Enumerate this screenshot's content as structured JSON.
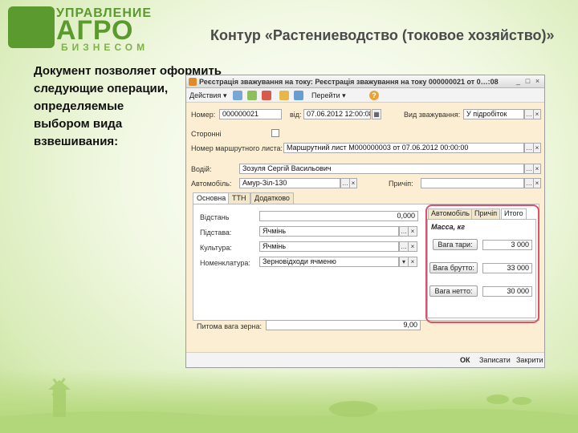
{
  "logo": {
    "top": "УПРАВЛЕНИЕ",
    "big": "АГРО",
    "bottom": "БИЗНЕСОМ"
  },
  "slide_title": "Контур «Растениеводство (токовое хозяйство)»",
  "description": [
    "Документ позволяет оформить",
    "следующие операции,",
    "определяемые",
    "выбором вида",
    "взвешивания:"
  ],
  "window": {
    "title": "Реєстрація зважування на току: Реєстрація зважування на току 000000021 от 0…:08",
    "controls": {
      "minimize": "_",
      "maximize": "□",
      "close": "×"
    },
    "toolbar": {
      "actions": "Действия",
      "go_to": "Перейти",
      "help": "?"
    },
    "labels": {
      "number": "Номер:",
      "date": "від:",
      "weighing_type": "Вид зважування:",
      "third_party": "Сторонні",
      "route_sheet": "Номер маршрутного листа:",
      "driver": "Водій:",
      "vehicle": "Автомобіль:",
      "trailer": "Причіп:"
    },
    "values": {
      "number": "000000021",
      "date": "07.06.2012 12:00:08",
      "weighing_type": "У підробіток",
      "route_sheet": "Маршрутний лист М000000003 от 07.06.2012 00:00:00",
      "driver": "Зозуля Сергій Васильович",
      "vehicle": "Амур-Зіл-130",
      "trailer": ""
    },
    "tabs": [
      "Основна",
      "ТТН",
      "Додатково"
    ],
    "main_tab": {
      "labels": {
        "distance": "Відстань",
        "basis": "Підстава:",
        "crop": "Культура:",
        "nomenclature": "Номенклатура:",
        "density": "Питома вага зерна:"
      },
      "values": {
        "distance": "0,000",
        "basis": "Ячмінь",
        "crop": "Ячмінь",
        "nomenclature": "Зерновідходи ячменю",
        "density": "9,00"
      }
    },
    "sub_tabs": [
      "Автомобіль",
      "Причіп",
      "Итого"
    ],
    "totals": {
      "heading": "Масса, кг",
      "tare_button": "Вага тари:",
      "gross_button": "Вага брутто:",
      "net_button": "Вага нетто:",
      "tare_value": "3 000",
      "gross_value": "33 000",
      "net_value": "30 000"
    },
    "bottom": {
      "ok": "ОК",
      "save": "Записати",
      "close": "Закрити"
    }
  }
}
